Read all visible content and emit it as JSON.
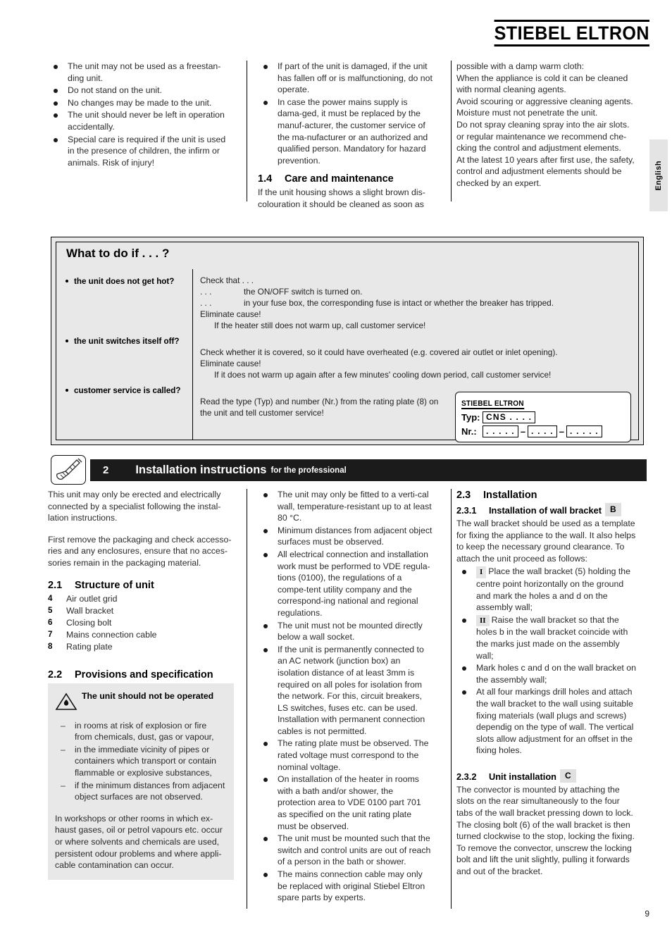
{
  "brand": "STIEBEL ELTRON",
  "side_tab": "English",
  "page_number": "9",
  "top": {
    "col1_bullets": [
      "The unit may not be used as a freestan-ding unit.",
      "Do not stand on the unit.",
      "No changes may be made to the unit.",
      "The unit should never be left in operation accidentally.",
      "Special care is required if the unit is used in the presence of children, the infirm or animals. Risk of injury!"
    ],
    "col2_bullets": [
      "If part of the unit is damaged, if the unit has fallen off or is malfunctioning, do not operate.",
      "In case the power mains supply is dama-ged, it must be replaced by the manuf-acturer, the customer service of the ma-nufacturer or an authorized and qualified person. Mandatory for hazard prevention."
    ],
    "care_heading_num": "1.4",
    "care_heading": "Care and maintenance",
    "care_text": "If the unit housing shows a slight brown dis-colouration it should be cleaned as soon as",
    "col3_lines": [
      "possible with a damp warm cloth:",
      "When the appliance is cold it can be cleaned",
      "with normal cleaning agents.",
      "Avoid scouring or aggressive cleaning agents.",
      "Moisture must not penetrate the unit.",
      "Do not spray cleaning spray into the air slots.",
      "or regular maintenance we recommend che-",
      "cking the control and adjustment elements.",
      "At the latest 10 years after first use, the safety,",
      "control and adjustment elements should be",
      "checked by an expert."
    ]
  },
  "what_to_do": {
    "title": "What to do if . . . ?",
    "questions": [
      "the unit does not get hot?",
      "the unit switches itself off?",
      "customer service is called?"
    ],
    "answer1": {
      "line1": "Check that . . .",
      "lead": ". . .",
      "line2": "the ON/OFF switch is turned on.",
      "line3": "in your fuse box, the corresponding fuse is intact or whether the breaker has tripped.",
      "line4": "Eliminate cause!",
      "line5": "If the heater still does not warm up, call customer service!"
    },
    "answer2": {
      "line1": "Check whether it is covered, so it could have overheated (e.g. covered air outlet or inlet opening).",
      "line2": "Eliminate cause!",
      "line3": "If it does not warm up again after a few minutes' cooling down period, call customer service!"
    },
    "answer3": {
      "line1": "Read the type (Typ) and number (Nr.) from the rating plate (8) on",
      "line2": "the unit and tell customer service!"
    },
    "plate": {
      "brand": "STIEBEL ELTRON",
      "typ_label": "Typ:",
      "typ_value": "CNS . . . .",
      "nr_label": "Nr.:",
      "nr_part1": ". . . . .",
      "nr_part2": ". . . .",
      "nr_part3": ". . . . .",
      "dash": "–"
    }
  },
  "section2": {
    "icon": "screwdriver-icon",
    "number": "2",
    "title": "Installation instructions",
    "subtitle": "for the professional",
    "left": {
      "intro1": "This unit may only be erected and electrically connected by a specialist following the instal-lation instructions.",
      "intro2": "First remove the packaging and check accesso-ries and any enclosures, ensure that no acces-sories remain in the packaging material.",
      "h21_num": "2.1",
      "h21_title": "Structure of unit",
      "structure_items": [
        {
          "key": "4",
          "label": "Air outlet grid"
        },
        {
          "key": "5",
          "label": "Wall bracket"
        },
        {
          "key": "6",
          "label": "Closing bolt"
        },
        {
          "key": "7",
          "label": "Mains connection cable"
        },
        {
          "key": "8",
          "label": "Rating plate"
        }
      ],
      "h22_num": "2.2",
      "h22_title": "Provisions and specification",
      "warn_title": "The unit should not be operated",
      "warn_icon": "warning-flammable-icon",
      "warn_items": [
        "in rooms at risk of explosion or fire from chemicals, dust, gas or vapour,",
        "in the immediate vicinity of pipes or containers which transport or contain flammable or explosive substances,",
        "if the minimum distances from adjacent object surfaces are not observed."
      ],
      "warn_footer": "In workshops or other rooms in which ex-haust gases, oil or petrol vapours etc. occur or where solvents and chemicals are used, persistent odour problems and where appli-cable contamination can occur."
    },
    "middle_bullets": [
      "The unit may only be fitted to a verti-cal wall, temperature-resistant up to at least 80 °C.",
      "Minimum distances from adjacent object surfaces must be observed.",
      "All electrical connection and installation work must be performed to VDE regula-tions (0100), the regulations of a compe-tent utility company and the correspond-ing national and regional regulations.",
      "The unit must not be mounted directly below a wall socket.",
      "If the unit is permanently connected to an AC network (junction box) an isolation distance of at least 3mm is required on all poles for isolation from the network. For this, circuit breakers, LS switches, fuses etc. can be used.\nInstallation with permanent connection cables is not permitted.",
      "The rating plate must be observed. The rated voltage must correspond to the nominal voltage.",
      "On installation of the heater in rooms with a bath and/or shower, the protection area to VDE 0100 part 701 as specified on the unit rating plate must be observed.",
      "The unit must be mounted such that the switch and control units are out of reach of a person in the bath or shower.",
      "The mains connection cable may only be replaced with original Stiebel Eltron spare parts by experts."
    ],
    "right": {
      "h23_num": "2.3",
      "h23_title": "Installation",
      "h231_num": "2.3.1",
      "h231_title": "Installation of wall bracket",
      "h231_tag": "B",
      "para1": "The wall bracket should be used as a template for fixing the appliance to the wall. It also helps to keep the necessary ground clearance. To attach the unit proceed as follows:",
      "steps": [
        {
          "marker": "I",
          "text": "Place the wall bracket (5) holding the centre point horizontally on the ground and mark the holes a and d on the assembly wall;"
        },
        {
          "marker": "II",
          "text": "Raise the wall bracket so that the holes b in the wall bracket coincide with the marks just made on the assembly wall;"
        },
        {
          "marker": "",
          "text": "Mark holes c and d on the wall bracket on the assembly wall;"
        },
        {
          "marker": "",
          "text": "At all four markings drill holes and attach the wall bracket to the wall using suitable fixing materials (wall plugs and screws) dependig on the type of wall. The vertical slots allow adjustment for an offset in the fixing holes."
        }
      ],
      "h232_num": "2.3.2",
      "h232_title": "Unit installation",
      "h232_tag": "C",
      "para2": "The convector is mounted by attaching the slots on the rear simultaneously to the four tabs of the wall bracket pressing down to lock. The closing bolt (6) of the wall bracket is then turned clockwise to the stop, locking the fixing. To remove the convector, unscrew the locking bolt and lift the unit slightly, pulling it forwards and out of the bracket."
    }
  }
}
